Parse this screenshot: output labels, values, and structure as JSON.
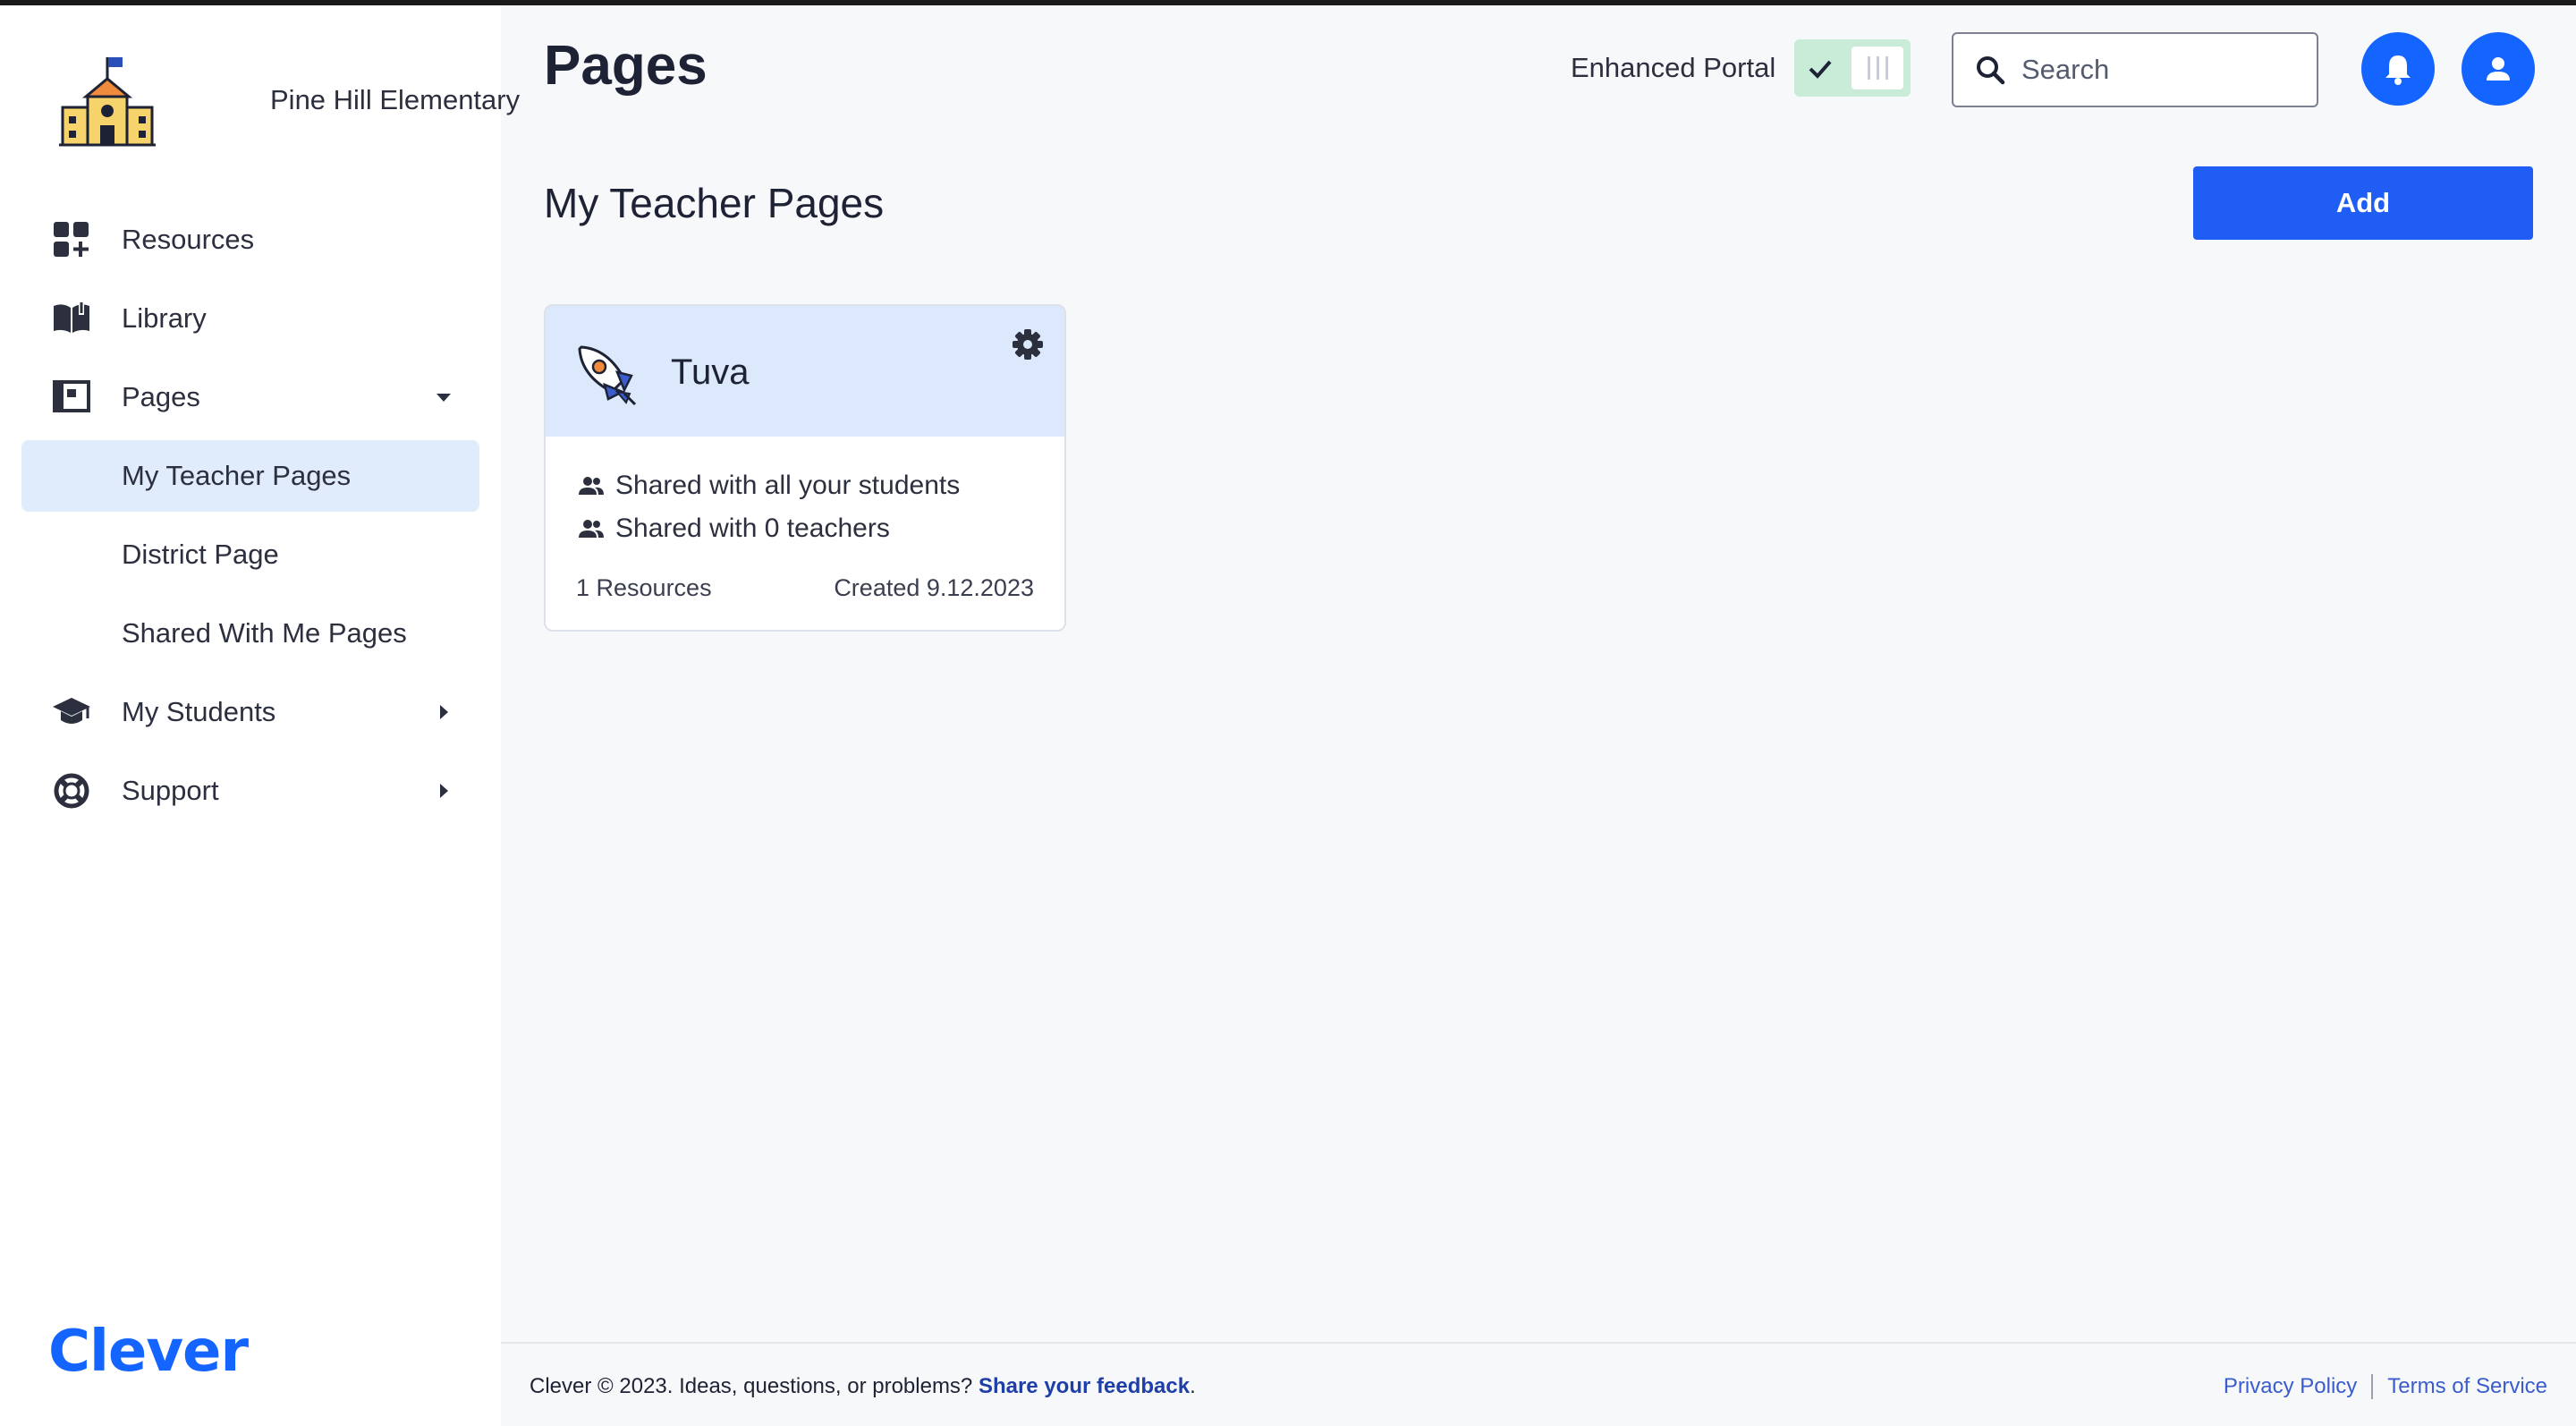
{
  "school": {
    "name": "Pine Hill Elementary",
    "logo_icon": "school-building-icon"
  },
  "sidebar": {
    "items": [
      {
        "label": "Resources",
        "icon": "grid-plus-icon"
      },
      {
        "label": "Library",
        "icon": "open-book-icon"
      },
      {
        "label": "Pages",
        "icon": "pages-icon",
        "expanded": true
      },
      {
        "label": "My Teacher Pages",
        "active": true
      },
      {
        "label": "District Page"
      },
      {
        "label": "Shared With Me Pages"
      },
      {
        "label": "My Students",
        "icon": "graduation-cap-icon",
        "expanded": false
      },
      {
        "label": "Support",
        "icon": "lifebuoy-icon",
        "expanded": false
      }
    ],
    "brand": "Clever"
  },
  "header": {
    "title": "Pages",
    "enhanced_portal_label": "Enhanced Portal",
    "enhanced_portal_on": true,
    "search_placeholder": "Search"
  },
  "main": {
    "section_title": "My Teacher Pages",
    "add_label": "Add",
    "cards": [
      {
        "title": "Tuva",
        "icon": "rocket-icon",
        "shared_students": "Shared with all your students",
        "shared_teachers": "Shared with 0 teachers",
        "resources": "1 Resources",
        "created": "Created 9.12.2023"
      }
    ]
  },
  "footer": {
    "text": "Clever © 2023. Ideas, questions, or problems?",
    "feedback_link": "Share your feedback",
    "period": ".",
    "privacy": "Privacy Policy",
    "terms": "Terms of Service"
  },
  "colors": {
    "accent": "#1464ff",
    "sidebar_active": "#e0ebfb",
    "card_header": "#dce8fb",
    "toggle_on": "#c9ecd8"
  }
}
